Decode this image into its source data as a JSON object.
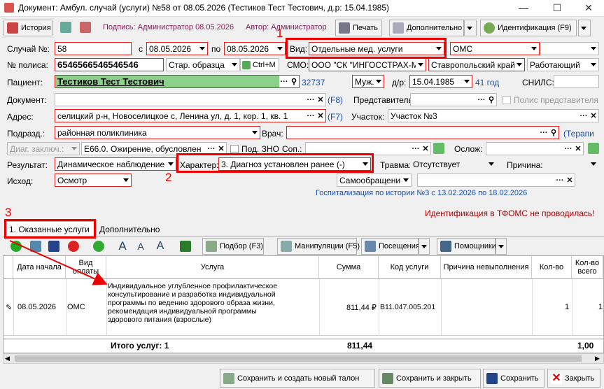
{
  "window": {
    "title": "Документ: Амбул. случай (услуги) №58 от 08.05.2026 (Тестиков Тест Тестович, д.р: 15.04.1985)"
  },
  "toolbar": {
    "history": "История",
    "sign": "Подпись: Администратор 08.05.2026",
    "author": "Автор: Администратор",
    "print": "Печать",
    "extra": "Дополнительно",
    "ident": "Идентификация (F9)"
  },
  "form": {
    "case_label": "Случай №:",
    "case_no": "58",
    "from_label": "с",
    "date_from": "08.05.2026",
    "to_label": "по",
    "date_to": "08.05.2026",
    "vid_label": "Вид:",
    "vid": "Отдельные мед. услуги",
    "payment": "ОМС",
    "policy_label": "№ полиса:",
    "policy": "6546566546546546",
    "policy_type": "Стар. образца",
    "ctrlm": "Ctrl+M",
    "smo_label": "СМО:",
    "smo": "ООО \"СК \"ИНГОССТРАХ-М",
    "region": "Ставропольский край",
    "work": "Работающий",
    "patient_label": "Пациент:",
    "patient": "Тестиков Тест Тестович",
    "patient_id": "32737",
    "sex": "Муж.",
    "dob_label": "д/р:",
    "dob": "15.04.1985",
    "age": "41 год",
    "snils_label": "СНИЛС:",
    "doc_label": "Документ:",
    "f8": "(F8)",
    "rep_label": "Представитель:",
    "rep_policy": "Полис представителя",
    "addr_label": "Адрес:",
    "addr": "селицкий р-н, Новоселицкое с, Ленина ул, д. 1, кор. 1, кв. 1",
    "f7": "(F7)",
    "uch_label": "Участок:",
    "uch": "Участок №3",
    "podr_label": "Подразд.:",
    "podr": "районная поликлиника",
    "vrach_label": "Врач:",
    "terap": "(Терапи",
    "diag_label": "Диаг. заключ.:",
    "diag": "E66.0. Ожирение, обусловлен",
    "zno": "Под. ЗНО",
    "sop_label": "Соп.:",
    "oslozh_label": "Ослож:",
    "result_label": "Результат:",
    "result": "Динамическое наблюдение",
    "har_label": "Характер:",
    "har": "3. Диагноз установлен ранее (-)",
    "trauma_label": "Травма:",
    "trauma": "Отсутствует",
    "reason_label": "Причина:",
    "ishod_label": "Исход:",
    "ishod": "Осмотр",
    "self": "Самообращени",
    "hosp": "Госпитализация по истории №3 с 13.02.2026 по 18.02.2026",
    "tfoms": "Идентификация в ТФОМС не проводилась!"
  },
  "annotations": {
    "n1": "1",
    "n2": "2",
    "n3": "3"
  },
  "tabs": {
    "t1": "1. Оказанные услуги",
    "t2": "Дополнительно"
  },
  "tb2": {
    "podbor": "Подбор (F3)",
    "manip": "Манипуляции (F5)",
    "posesh": "Посещения",
    "pomosh": "Помощники"
  },
  "grid": {
    "headers": [
      "Дата начала",
      "Вид оплаты",
      "Услуга",
      "Сумма",
      "Код услуги",
      "Причина невыполнения",
      "Кол-во",
      "Кол-во всего"
    ],
    "row": {
      "date": "08.05.2026",
      "pay": "ОМС",
      "service": "Индивидуальное углубленное профилактическое консультирование и разработка индивидуальной программы по ведению здорового образа жизни, рекомендация индивидуальной программы здорового питания (взрослые)",
      "sum": "811,44 ₽",
      "code": "В11.047.005.201",
      "qty": "1",
      "qty_total": "1"
    },
    "total_label": "Итого услуг: 1",
    "total_sum": "811,44",
    "total_qty": "1,00"
  },
  "bottom": {
    "save_new": "Сохранить и создать новый талон",
    "save_close": "Сохранить и закрыть",
    "save": "Сохранить",
    "close": "Закрыть"
  }
}
